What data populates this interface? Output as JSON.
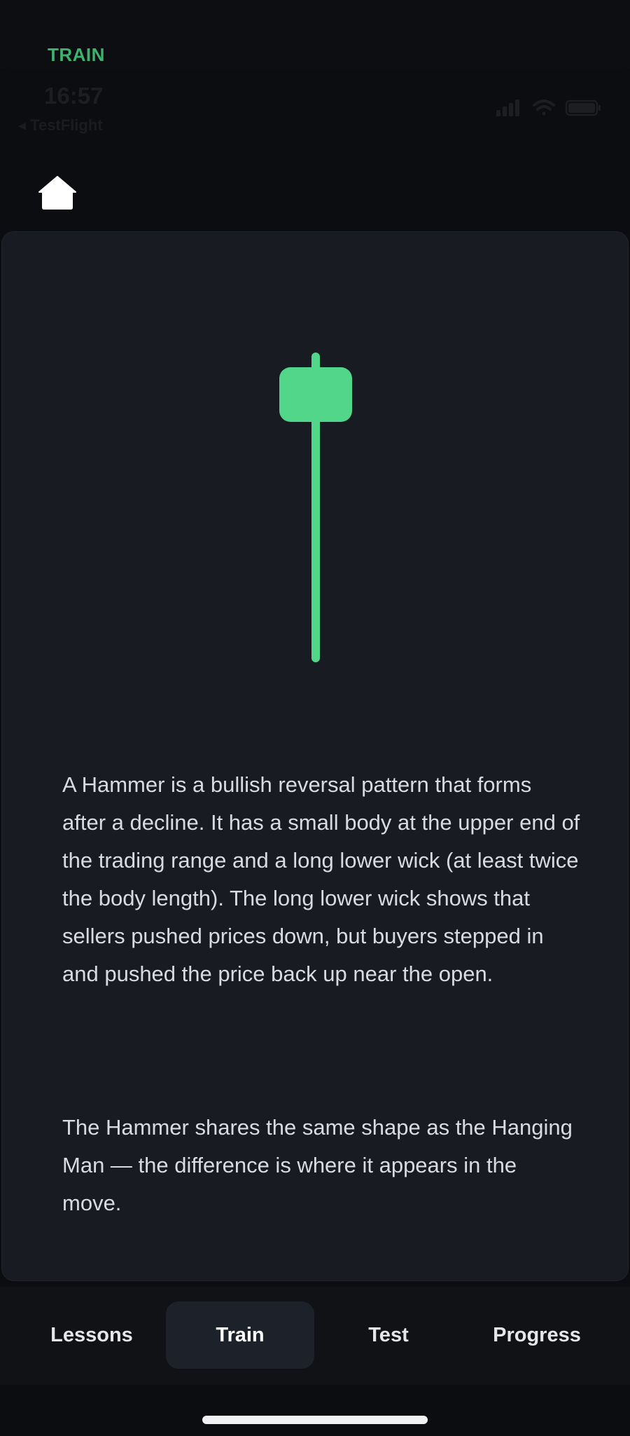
{
  "header": {
    "mode_label": "TRAIN"
  },
  "status_bar": {
    "time": "16:57",
    "back_label": "◂ TestFlight",
    "icons": [
      "cellular-signal-icon",
      "wifi-icon",
      "battery-icon"
    ]
  },
  "nav": {
    "home_icon": "home-icon"
  },
  "lesson": {
    "candle": {
      "type": "hammer",
      "color": "#52d68a"
    },
    "paragraphs": [
      "A Hammer is a bullish reversal pattern that forms after a decline. It has a small body at the upper end of the trading range and a long lower wick (at least twice the body length). The long lower wick shows that sellers pushed prices down, but buyers stepped in and pushed the price back up near the open.",
      "The Hammer shares the same shape as the Hanging Man — the difference is where it appears in the move."
    ]
  },
  "tabs": [
    {
      "label": "Lessons",
      "active": false
    },
    {
      "label": "Train",
      "active": true
    },
    {
      "label": "Test",
      "active": false
    },
    {
      "label": "Progress",
      "active": false
    }
  ],
  "colors": {
    "accent": "#52d68a",
    "mode_label": "#3cb46e",
    "card_bg": "#181b22",
    "background": "#0c0d10"
  }
}
